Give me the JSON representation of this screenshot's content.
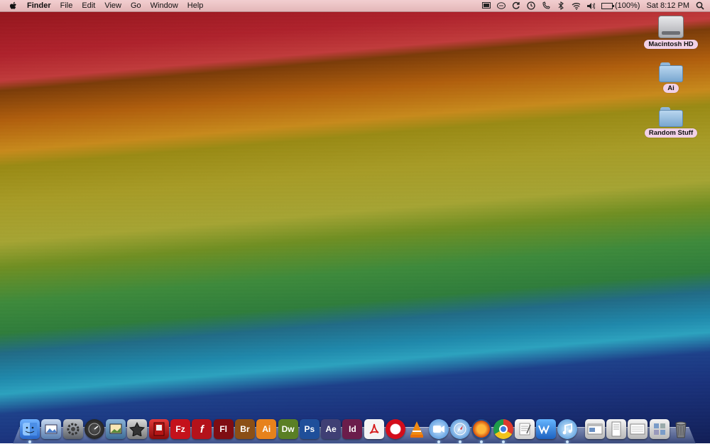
{
  "menubar": {
    "apple_icon": "apple-logo-icon",
    "items": [
      "Finder",
      "File",
      "Edit",
      "View",
      "Go",
      "Window",
      "Help"
    ],
    "status": {
      "battery": "(100%)",
      "battery_level": 1.0,
      "clock": "Sat 8:12 PM"
    }
  },
  "desktop": {
    "icons": [
      {
        "label": "Macintosh HD",
        "icon": "hard-drive-icon"
      },
      {
        "label": "Ai",
        "icon": "folder-icon"
      },
      {
        "label": "Random Stuff",
        "icon": "folder-icon"
      }
    ]
  },
  "dock": {
    "text_icons": {
      "filezilla": "Fz",
      "flash_player": "f",
      "flash": "Fl",
      "bridge": "Br",
      "illustrator": "Ai",
      "dreamweaver": "Dw",
      "photoshop": "Ps",
      "after_effects": "Ae",
      "indesign": "Id",
      "opera": "O"
    },
    "colors": {
      "filezilla": "#c4121b",
      "flash_player": "#b4121a",
      "flash": "#7f0d12",
      "bridge": "#8b4f16",
      "illustrator": "#e7821c",
      "dreamweaver": "#5a7f25",
      "photoshop": "#1f4f9a",
      "after_effects": "#3f3f74",
      "indesign": "#6b1d4b",
      "opera": "#d30d1b"
    }
  }
}
